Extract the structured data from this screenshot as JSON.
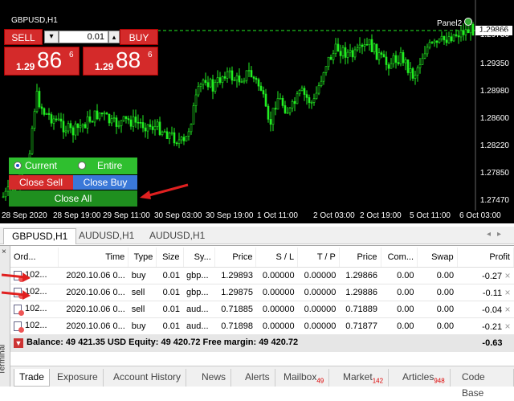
{
  "chart": {
    "symbol_label": "GBPUSD,H1",
    "panel_label": "Panel2",
    "current_price": "1.29866",
    "price_ticks": [
      "1.29730",
      "1.29350",
      "1.28980",
      "1.28600",
      "1.28220",
      "1.27850",
      "1.27470"
    ],
    "time_ticks": [
      "28 Sep 2020",
      "28 Sep 19:00",
      "29 Sep 11:00",
      "30 Sep 03:00",
      "30 Sep 19:00",
      "1 Oct 11:00",
      "2 Oct 03:00",
      "2 Oct 19:00",
      "5 Oct 11:00",
      "6 Oct 03:00"
    ],
    "colors": {
      "background": "#000000",
      "candle": "#22ee22",
      "bid_line": "#22ee22"
    }
  },
  "one_click": {
    "sell_label": "SELL",
    "buy_label": "BUY",
    "lot_value": "0.01",
    "minus_icon": "chevron-down-icon",
    "plus_icon": "chevron-up-icon",
    "sell_quote": {
      "prefix": "1.29",
      "big": "86",
      "sup": "6"
    },
    "buy_quote": {
      "prefix": "1.29",
      "big": "88",
      "sup": "6"
    }
  },
  "close_panel": {
    "current_label": "Current",
    "entire_label": "Entire",
    "close_sell_label": "Close Sell",
    "close_buy_label": "Close Buy",
    "close_all_label": "Close All"
  },
  "chart_tabs": [
    "GBPUSD,H1",
    "AUDUSD,H1",
    "AUDUSD,H1"
  ],
  "terminal": {
    "side_label": "Terminal",
    "columns": [
      "Ord...",
      "Time",
      "Type",
      "Size",
      "Sy...",
      "Price",
      "S / L",
      "T / P",
      "Price",
      "Com...",
      "Swap",
      "Profit"
    ],
    "rows": [
      [
        "102...",
        "2020.10.06 0...",
        "buy",
        "0.01",
        "gbp...",
        "1.29893",
        "0.00000",
        "0.00000",
        "1.29866",
        "0.00",
        "0.00",
        "-0.27"
      ],
      [
        "102...",
        "2020.10.06 0...",
        "sell",
        "0.01",
        "gbp...",
        "1.29875",
        "0.00000",
        "0.00000",
        "1.29886",
        "0.00",
        "0.00",
        "-0.11"
      ],
      [
        "102...",
        "2020.10.06 0...",
        "sell",
        "0.01",
        "aud...",
        "0.71885",
        "0.00000",
        "0.00000",
        "0.71889",
        "0.00",
        "0.00",
        "-0.04"
      ],
      [
        "102...",
        "2020.10.06 0...",
        "buy",
        "0.01",
        "aud...",
        "0.71898",
        "0.00000",
        "0.00000",
        "0.71877",
        "0.00",
        "0.00",
        "-0.21"
      ]
    ],
    "summary": {
      "text": "Balance: 49 421.35 USD  Equity: 49 420.72  Free margin: 49 420.72",
      "profit": "-0.63"
    },
    "bottom_tabs": [
      {
        "label": "Trade",
        "badge": ""
      },
      {
        "label": "Exposure",
        "badge": ""
      },
      {
        "label": "Account History",
        "badge": ""
      },
      {
        "label": "News",
        "badge": ""
      },
      {
        "label": "Alerts",
        "badge": ""
      },
      {
        "label": "Mailbox",
        "badge": "49"
      },
      {
        "label": "Market",
        "badge": "142"
      },
      {
        "label": "Articles",
        "badge": "948"
      },
      {
        "label": "Code Base",
        "badge": ""
      }
    ]
  }
}
